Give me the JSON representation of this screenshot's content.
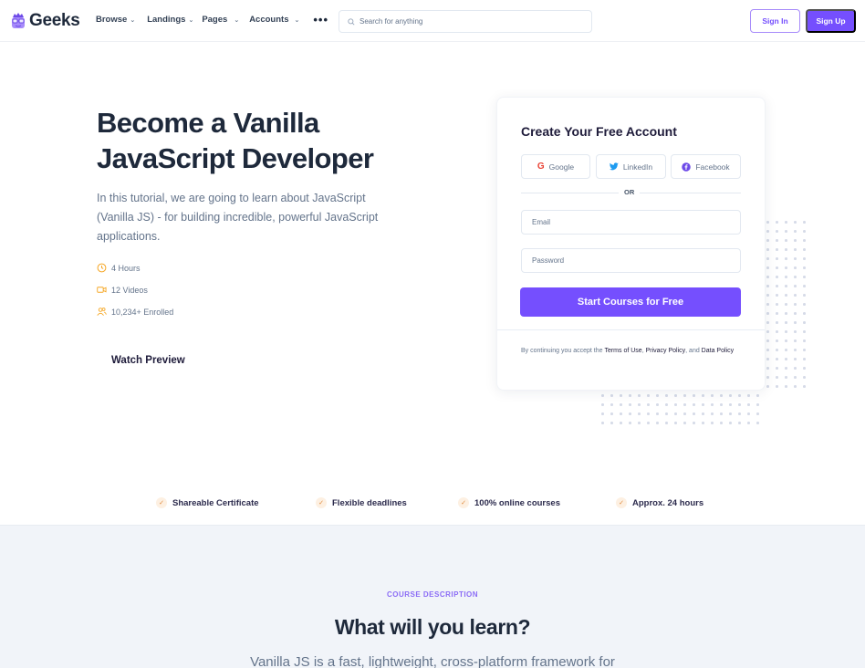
{
  "navbar": {
    "brand": "Geeks",
    "menu": [
      {
        "label": "Browse"
      },
      {
        "label": "Landings"
      },
      {
        "label": "Pages"
      },
      {
        "label": "Accounts"
      }
    ],
    "more_icon": "ellipsis-icon",
    "search": {
      "placeholder": "Search for anything",
      "value": ""
    },
    "sign_in": "Sign In",
    "sign_up": "Sign Up"
  },
  "hero": {
    "title": "Become a Vanilla JavaScript Developer",
    "description": "In this tutorial, we are going to learn about JavaScript (Vanilla JS) - for building incredible, powerful JavaScript applications.",
    "meta": [
      {
        "icon": "clock-icon",
        "label": "4 Hours"
      },
      {
        "icon": "video-icon",
        "label": "12 Videos"
      },
      {
        "icon": "users-icon",
        "label": "10,234+ Enrolled"
      }
    ],
    "watch_preview": "Watch Preview"
  },
  "signup_card": {
    "title": "Create Your Free Account",
    "social": [
      {
        "icon": "google-icon",
        "label": "Google"
      },
      {
        "icon": "twitter-icon",
        "label": "LinkedIn"
      },
      {
        "icon": "facebook-icon",
        "label": "Facebook"
      }
    ],
    "divider_text": "OR",
    "email": {
      "placeholder": "Email",
      "value": ""
    },
    "password": {
      "placeholder": "Password",
      "value": ""
    },
    "submit": "Start Courses for Free",
    "terms": {
      "prefix": "By continuing you accept the ",
      "terms_link": "Terms of Use",
      "sep1": ", ",
      "privacy_link": "Privacy Policy",
      "sep2": ", and ",
      "data_link": "Data Policy"
    }
  },
  "features": [
    {
      "icon": "check-icon",
      "label": "Shareable Certificate"
    },
    {
      "icon": "check-icon",
      "label": "Flexible deadlines"
    },
    {
      "icon": "check-icon",
      "label": "100% online courses"
    },
    {
      "icon": "check-icon",
      "label": "Approx. 24 hours"
    }
  ],
  "course_description": {
    "eyebrow": "COURSE DESCRIPTION",
    "title": "What will you learn?",
    "text": "Vanilla JS is a fast, lightweight, cross-platform framework for"
  },
  "colors": {
    "primary": "#754ffe",
    "heading": "#1e293b",
    "muted": "#64748b",
    "accent_orange": "#f5a623",
    "section_bg": "#f1f4f9"
  }
}
